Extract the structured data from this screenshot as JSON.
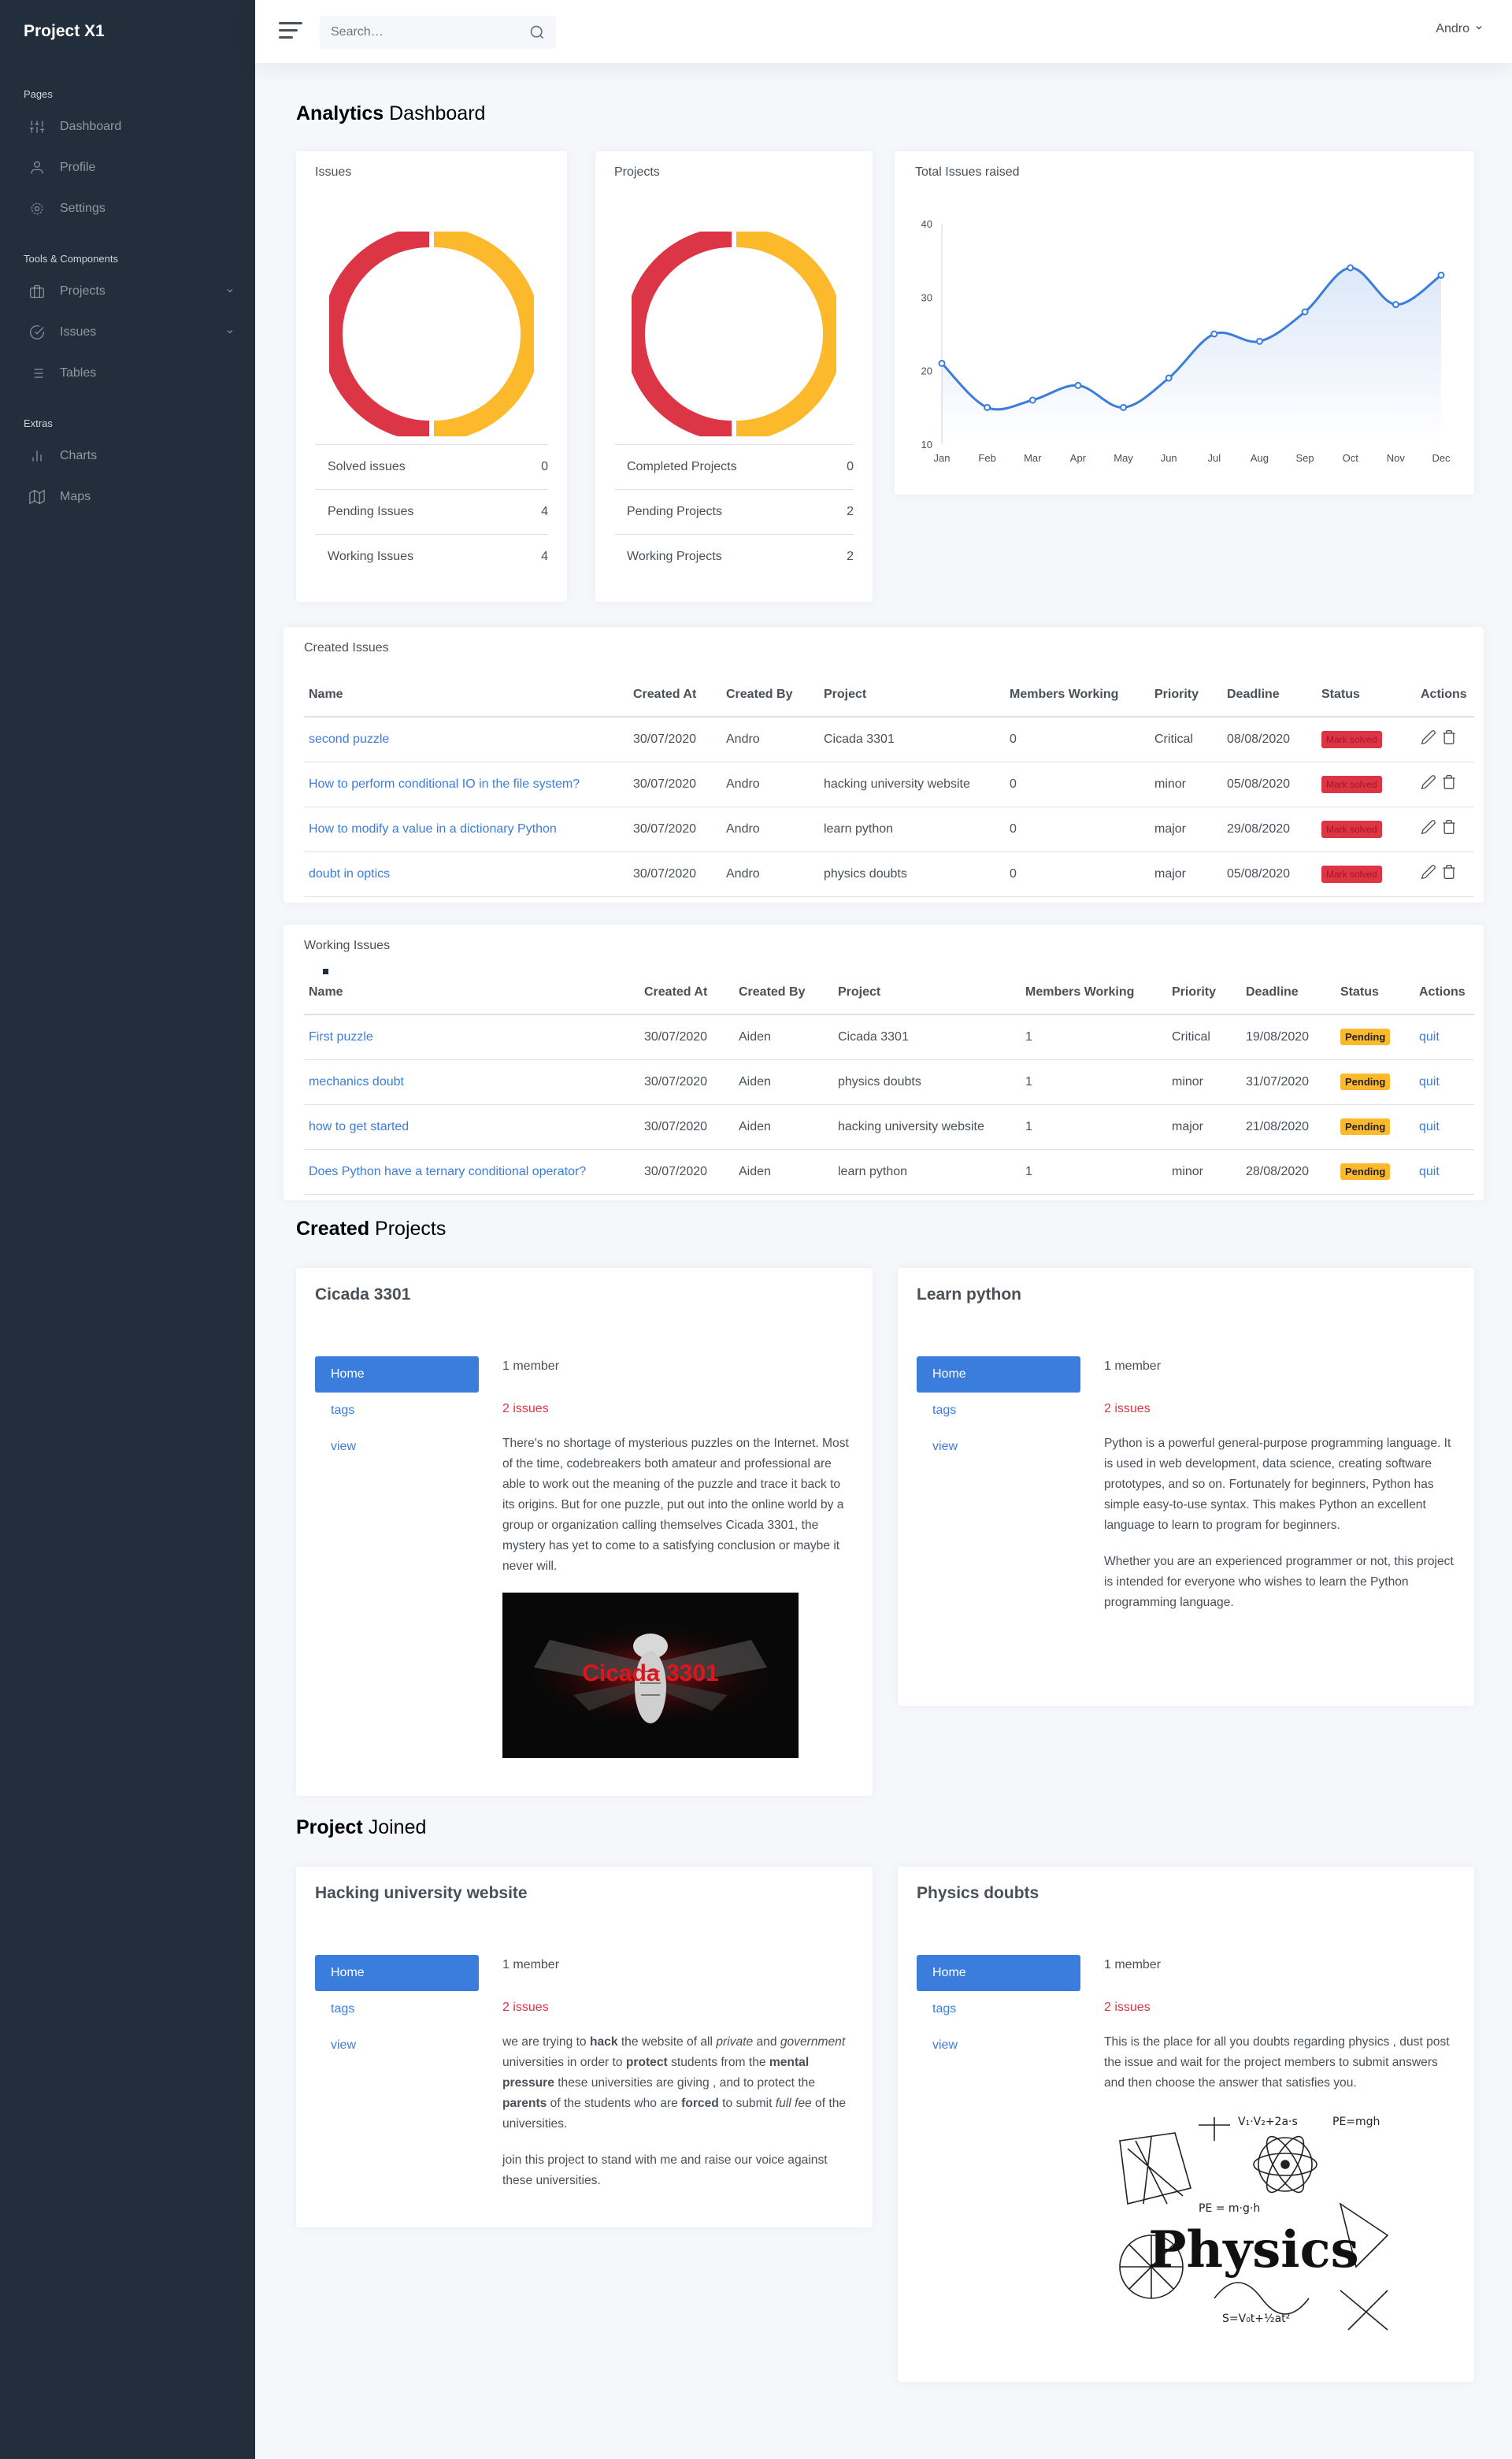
{
  "brand": "Project X1",
  "sidebar": {
    "sections": [
      {
        "header": "Pages",
        "items": [
          {
            "label": "Dashboard",
            "icon": "sliders-icon"
          },
          {
            "label": "Profile",
            "icon": "user-icon"
          },
          {
            "label": "Settings",
            "icon": "gear-icon"
          }
        ]
      },
      {
        "header": "Tools & Components",
        "items": [
          {
            "label": "Projects",
            "icon": "briefcase-icon",
            "chevron": true
          },
          {
            "label": "Issues",
            "icon": "check-circle-icon",
            "chevron": true
          },
          {
            "label": "Tables",
            "icon": "list-icon"
          }
        ]
      },
      {
        "header": "Extras",
        "items": [
          {
            "label": "Charts",
            "icon": "bar-chart-icon"
          },
          {
            "label": "Maps",
            "icon": "map-icon"
          }
        ]
      }
    ]
  },
  "topbar": {
    "search_placeholder": "Search…",
    "user": "Andro"
  },
  "page_title": {
    "bold": "Analytics",
    "rest": " Dashboard"
  },
  "issues_card": {
    "title": "Issues",
    "rows": [
      {
        "label": "Solved issues",
        "value": "0"
      },
      {
        "label": "Pending Issues",
        "value": "4"
      },
      {
        "label": "Working Issues",
        "value": "4"
      }
    ]
  },
  "projects_card": {
    "title": "Projects",
    "rows": [
      {
        "label": "Completed Projects",
        "value": "0"
      },
      {
        "label": "Pending Projects",
        "value": "2"
      },
      {
        "label": "Working Projects",
        "value": "2"
      }
    ]
  },
  "colors": {
    "red": "#dc3545",
    "yellow": "#fcb92c",
    "blue": "#3b7ddd",
    "sidebar": "#222e3c"
  },
  "chart_data": {
    "type": "area",
    "title": "Total Issues raised",
    "categories": [
      "Jan",
      "Feb",
      "Mar",
      "Apr",
      "May",
      "Jun",
      "Jul",
      "Aug",
      "Sep",
      "Oct",
      "Nov",
      "Dec"
    ],
    "values": [
      21,
      15,
      16,
      18,
      15,
      19,
      25,
      24,
      28,
      34,
      29,
      33
    ],
    "ylim": [
      10,
      40
    ],
    "yticks": [
      10,
      20,
      30,
      40
    ]
  },
  "created_issues": {
    "title": "Created Issues",
    "columns": [
      "Name",
      "Created At",
      "Created By",
      "Project",
      "Members Working",
      "Priority",
      "Deadline",
      "Status",
      "Actions"
    ],
    "rows": [
      {
        "name": "second puzzle",
        "created_at": "30/07/2020",
        "created_by": "Andro",
        "project": "Cicada 3301",
        "members": "0",
        "priority": "Critical",
        "deadline": "08/08/2020",
        "status": "Mark solved"
      },
      {
        "name": "How to perform conditional IO in the file system?",
        "created_at": "30/07/2020",
        "created_by": "Andro",
        "project": "hacking university website",
        "members": "0",
        "priority": "minor",
        "deadline": "05/08/2020",
        "status": "Mark solved"
      },
      {
        "name": "How to modify a value in a dictionary Python",
        "created_at": "30/07/2020",
        "created_by": "Andro",
        "project": "learn python",
        "members": "0",
        "priority": "major",
        "deadline": "29/08/2020",
        "status": "Mark solved"
      },
      {
        "name": "doubt in optics",
        "created_at": "30/07/2020",
        "created_by": "Andro",
        "project": "physics doubts",
        "members": "0",
        "priority": "major",
        "deadline": "05/08/2020",
        "status": "Mark solved"
      }
    ]
  },
  "working_issues": {
    "title": "Working Issues",
    "columns": [
      "Name",
      "Created At",
      "Created By",
      "Project",
      "Members Working",
      "Priority",
      "Deadline",
      "Status",
      "Actions"
    ],
    "rows": [
      {
        "name": "First puzzle",
        "created_at": "30/07/2020",
        "created_by": "Aiden",
        "project": "Cicada 3301",
        "members": "1",
        "priority": "Critical",
        "deadline": "19/08/2020",
        "status": "Pending",
        "action": "quit"
      },
      {
        "name": "mechanics doubt",
        "created_at": "30/07/2020",
        "created_by": "Aiden",
        "project": "physics doubts",
        "members": "1",
        "priority": "minor",
        "deadline": "31/07/2020",
        "status": "Pending",
        "action": "quit"
      },
      {
        "name": "how to get started",
        "created_at": "30/07/2020",
        "created_by": "Aiden",
        "project": "hacking university website",
        "members": "1",
        "priority": "major",
        "deadline": "21/08/2020",
        "status": "Pending",
        "action": "quit"
      },
      {
        "name": "Does Python have a ternary conditional operator?",
        "created_at": "30/07/2020",
        "created_by": "Aiden",
        "project": "learn python",
        "members": "1",
        "priority": "minor",
        "deadline": "28/08/2020",
        "status": "Pending",
        "action": "quit"
      }
    ]
  },
  "created_projects_title": {
    "bold": "Created",
    "rest": " Projects"
  },
  "joined_projects_title": {
    "bold": "Project",
    "rest": " Joined"
  },
  "project_nav": [
    "Home",
    "tags",
    "view"
  ],
  "projects": {
    "cicada": {
      "title": "Cicada 3301",
      "members": "1 member",
      "issues": "2 issues",
      "paragraphs": [
        "There's no shortage of mysterious puzzles on the Internet. Most of the time, codebreakers both amateur and professional are able to work out the meaning of the puzzle and trace it back to its origins. But for one puzzle, put out into the online world by a group or organization calling themselves Cicada 3301, the mystery has yet to come to a satisfying conclusion or maybe it never will."
      ],
      "image_text": "Cicada 3301"
    },
    "python": {
      "title": "Learn python",
      "members": "1 member",
      "issues": "2 issues",
      "paragraphs": [
        "Python is a powerful general-purpose programming language. It is used in web development, data science, creating software prototypes, and so on. Fortunately for beginners, Python has simple easy-to-use syntax. This makes Python an excellent language to learn to program for beginners.",
        "Whether you are an experienced programmer or not, this project is intended for everyone who wishes to learn the Python programming language."
      ]
    },
    "hacking": {
      "title": "Hacking university website",
      "members": "1 member",
      "issues": "2 issues",
      "p1": [
        "we are trying to ",
        "hack",
        " the website of all ",
        "private",
        " and ",
        "government",
        " universities in order to ",
        "protect",
        " students from the ",
        "mental pressure",
        " these universities are giving , and to protect the ",
        "parents",
        " of the students who are ",
        "forced",
        " to submit ",
        "full fee",
        " of the universities."
      ],
      "p2": "join this project to stand with me and raise our voice against these universities."
    },
    "physics": {
      "title": "Physics doubts",
      "members": "1 member",
      "issues": "2 issues",
      "paragraphs": [
        "This is the place for all you doubts regarding physics , dust post the issue and wait for the project members to submit answers and then choose the answer that satisfies you."
      ],
      "image_text": "Physics"
    }
  }
}
